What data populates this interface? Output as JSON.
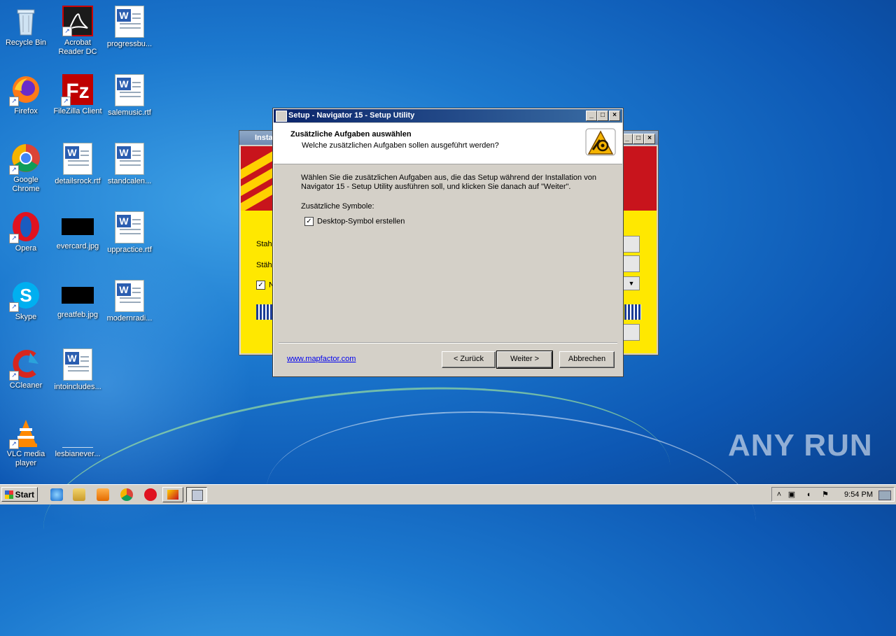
{
  "desktop": {
    "icons": [
      {
        "label": "Recycle Bin",
        "icon": "recycle-bin-icon"
      },
      {
        "label": "Acrobat Reader DC",
        "icon": "acrobat-icon"
      },
      {
        "label": "progressbu...",
        "icon": "word-doc-icon"
      },
      {
        "label": "Firefox",
        "icon": "firefox-icon"
      },
      {
        "label": "FileZilla Client",
        "icon": "filezilla-icon"
      },
      {
        "label": "salemusic.rtf",
        "icon": "word-doc-icon"
      },
      {
        "label": "Google Chrome",
        "icon": "chrome-icon"
      },
      {
        "label": "detailsrock.rtf",
        "icon": "word-doc-icon"
      },
      {
        "label": "standcalen...",
        "icon": "word-doc-icon"
      },
      {
        "label": "Opera",
        "icon": "opera-icon"
      },
      {
        "label": "evercard.jpg",
        "icon": "image-icon"
      },
      {
        "label": "uppractice.rtf",
        "icon": "word-doc-icon"
      },
      {
        "label": "Skype",
        "icon": "skype-icon"
      },
      {
        "label": "greatfeb.jpg",
        "icon": "image-icon"
      },
      {
        "label": "modernradi...",
        "icon": "word-doc-icon"
      },
      {
        "label": "CCleaner",
        "icon": "ccleaner-icon"
      },
      {
        "label": "intoincludes...",
        "icon": "word-doc-icon"
      },
      {
        "label": "VLC media player",
        "icon": "vlc-icon"
      },
      {
        "label": "lesbianever...",
        "icon": "image-icon"
      }
    ]
  },
  "background_window": {
    "title": "Insta",
    "line1": "Stahc",
    "line2": "Stähr",
    "check_label": "N"
  },
  "dialog": {
    "title": "Setup - Navigator 15 - Setup Utility",
    "header_title": "Zusätzliche Aufgaben auswählen",
    "header_subtitle": "Welche zusätzlichen Aufgaben sollen ausgeführt werden?",
    "description": "Wählen Sie die zusätzlichen Aufgaben aus, die das Setup während der Installation von Navigator 15 - Setup Utility ausführen soll, und klicken Sie danach auf \"Weiter\".",
    "group_label": "Zusätzliche Symbole:",
    "checkbox_label": "Desktop-Symbol erstellen",
    "checkbox_checked": true,
    "link": "www.mapfactor.com",
    "back_button": "< Zurück",
    "next_button": "Weiter >",
    "cancel_button": "Abbrechen"
  },
  "taskbar": {
    "start_label": "Start",
    "clock": "9:54 PM"
  },
  "watermark": "ANY RUN"
}
